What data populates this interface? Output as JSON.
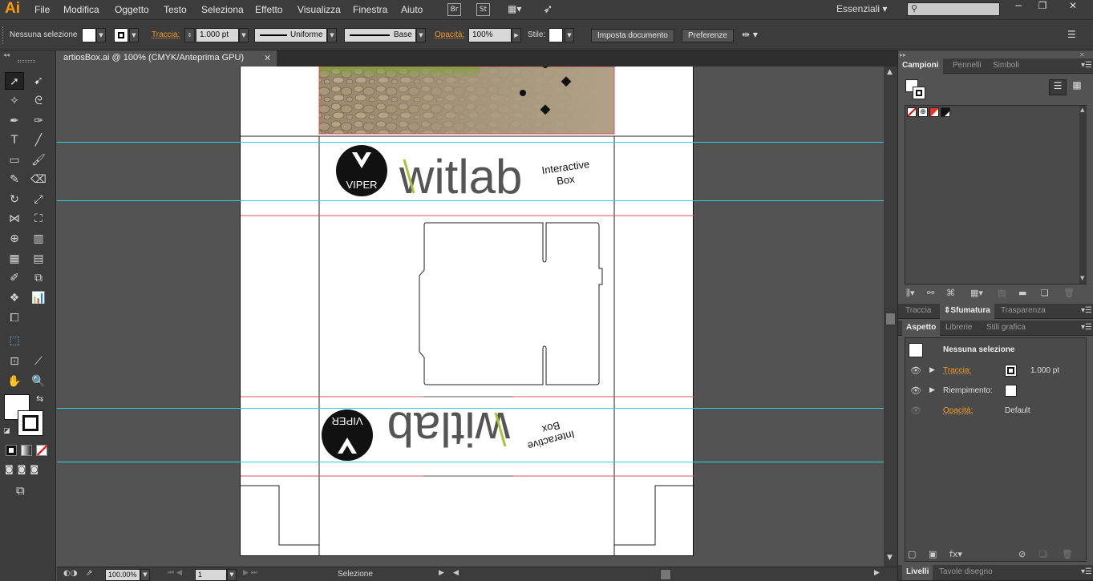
{
  "app": {
    "logo": "Ai",
    "workspace": "Essenziali"
  },
  "menu": [
    "File",
    "Modifica",
    "Oggetto",
    "Testo",
    "Seleziona",
    "Effetto",
    "Visualizza",
    "Finestra",
    "Aiuto"
  ],
  "bridge": {
    "br": "Br",
    "st": "St"
  },
  "control": {
    "selection": "Nessuna selezione",
    "stroke_label": "Traccia:",
    "stroke_value": "1.000 pt",
    "profile": "Uniforme",
    "brush": "Base",
    "opacity_label": "Opacità:",
    "opacity_value": "100%",
    "style_label": "Stile:",
    "doc_setup": "Imposta documento",
    "preferences": "Preferenze"
  },
  "document": {
    "tab_title": "artiosBox.ai @ 100% (CMYK/Anteprima GPU)"
  },
  "artwork": {
    "brand": "witlab",
    "logo_text": "VIPER",
    "tagline_1": "Interactive",
    "tagline_2": "Box"
  },
  "status": {
    "zoom": "100.00%",
    "page": "1",
    "tool": "Selezione"
  },
  "panels": {
    "top_tabs": [
      "Campioni",
      "Pennelli",
      "Simboli"
    ],
    "mid_tabs": [
      "Traccia",
      "Sfumatura",
      "Trasparenza"
    ],
    "appearance_tabs": [
      "Aspetto",
      "Librerie",
      "Stili grafica"
    ],
    "appearance": {
      "title": "Nessuna selezione",
      "stroke_label": "Traccia:",
      "stroke_value": "1.000 pt",
      "fill_label": "Riempimento:",
      "opacity_label": "Opacità:",
      "opacity_value": "Default"
    },
    "bottom_tabs": [
      "Livelli",
      "Tavole disegno"
    ]
  },
  "colors": {
    "accent": "#f29b25",
    "guide": "#2fd3e0",
    "bleed": "#e0505a",
    "lime": "#a4c63a"
  }
}
